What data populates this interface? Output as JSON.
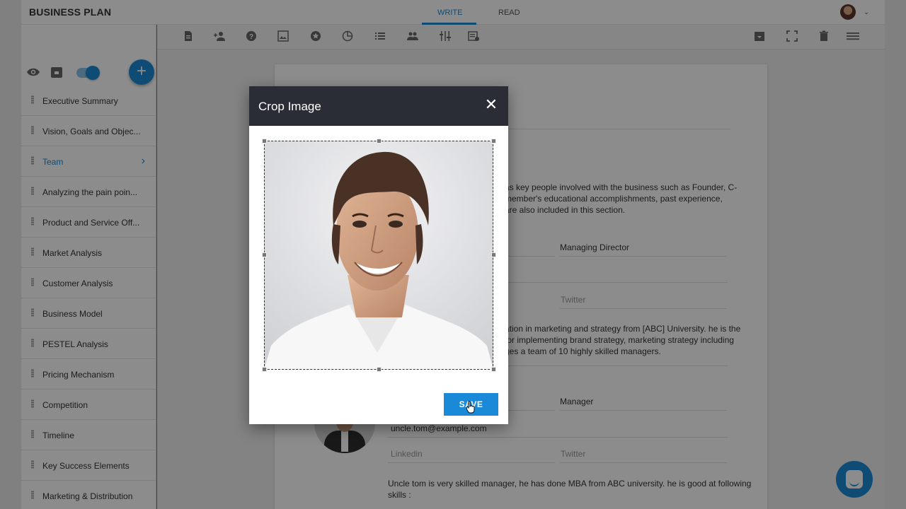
{
  "app": {
    "title": "BUSINESS PLAN"
  },
  "tabs": [
    {
      "label": "WRITE",
      "active": true
    },
    {
      "label": "READ",
      "active": false
    }
  ],
  "sidebar": {
    "items": [
      {
        "label": "Executive Summary"
      },
      {
        "label": "Vision, Goals and Objec..."
      },
      {
        "label": "Team",
        "active": true
      },
      {
        "label": "Analyzing the pain poin..."
      },
      {
        "label": "Product and Service Off..."
      },
      {
        "label": "Market Analysis"
      },
      {
        "label": "Customer Analysis"
      },
      {
        "label": "Business Model"
      },
      {
        "label": "PESTEL Analysis"
      },
      {
        "label": "Pricing Mechanism"
      },
      {
        "label": "Competition"
      },
      {
        "label": "Timeline"
      },
      {
        "label": "Key Success Elements"
      },
      {
        "label": "Marketing & Distribution"
      }
    ]
  },
  "toolbar": {
    "icons": [
      "document-icon",
      "add-person-icon",
      "help-icon",
      "image-icon",
      "star-icon",
      "pie-chart-icon",
      "list-icon",
      "team-icon",
      "columns-icon",
      "table-icon"
    ],
    "right_icons": [
      "archive-icon",
      "fullscreen-icon",
      "delete-icon",
      "menu-icon"
    ]
  },
  "document": {
    "intro_line1": "as key people involved with the business such as Founder, C-",
    "intro_line2": "member's educational accomplishments, past experience,",
    "intro_line3": "are also included in this section.",
    "member1_title": "Managing Director",
    "member1_twitter_placeholder": "Twitter",
    "member1_bio_line1": "ation in marketing and strategy from [ABC] University. he is the",
    "member1_bio_line2": "for implementing brand strategy, marketing strategy including",
    "member1_bio_line3": "ges a team of 10 highly skilled managers.",
    "member2_title": "Manager",
    "member2_email": "uncle.tom@example.com",
    "member2_linkedin_placeholder": "Linkedin",
    "member2_twitter_placeholder": "Twitter",
    "member2_bio_line1": "Uncle tom is very skilled manager,  he has done MBA from ABC university. he is good at following",
    "member2_bio_line2": "skills :"
  },
  "modal": {
    "title": "Crop Image",
    "save_label": "SAVE"
  },
  "colors": {
    "accent": "#1a8ad8",
    "modal_header": "#2a2d35"
  }
}
